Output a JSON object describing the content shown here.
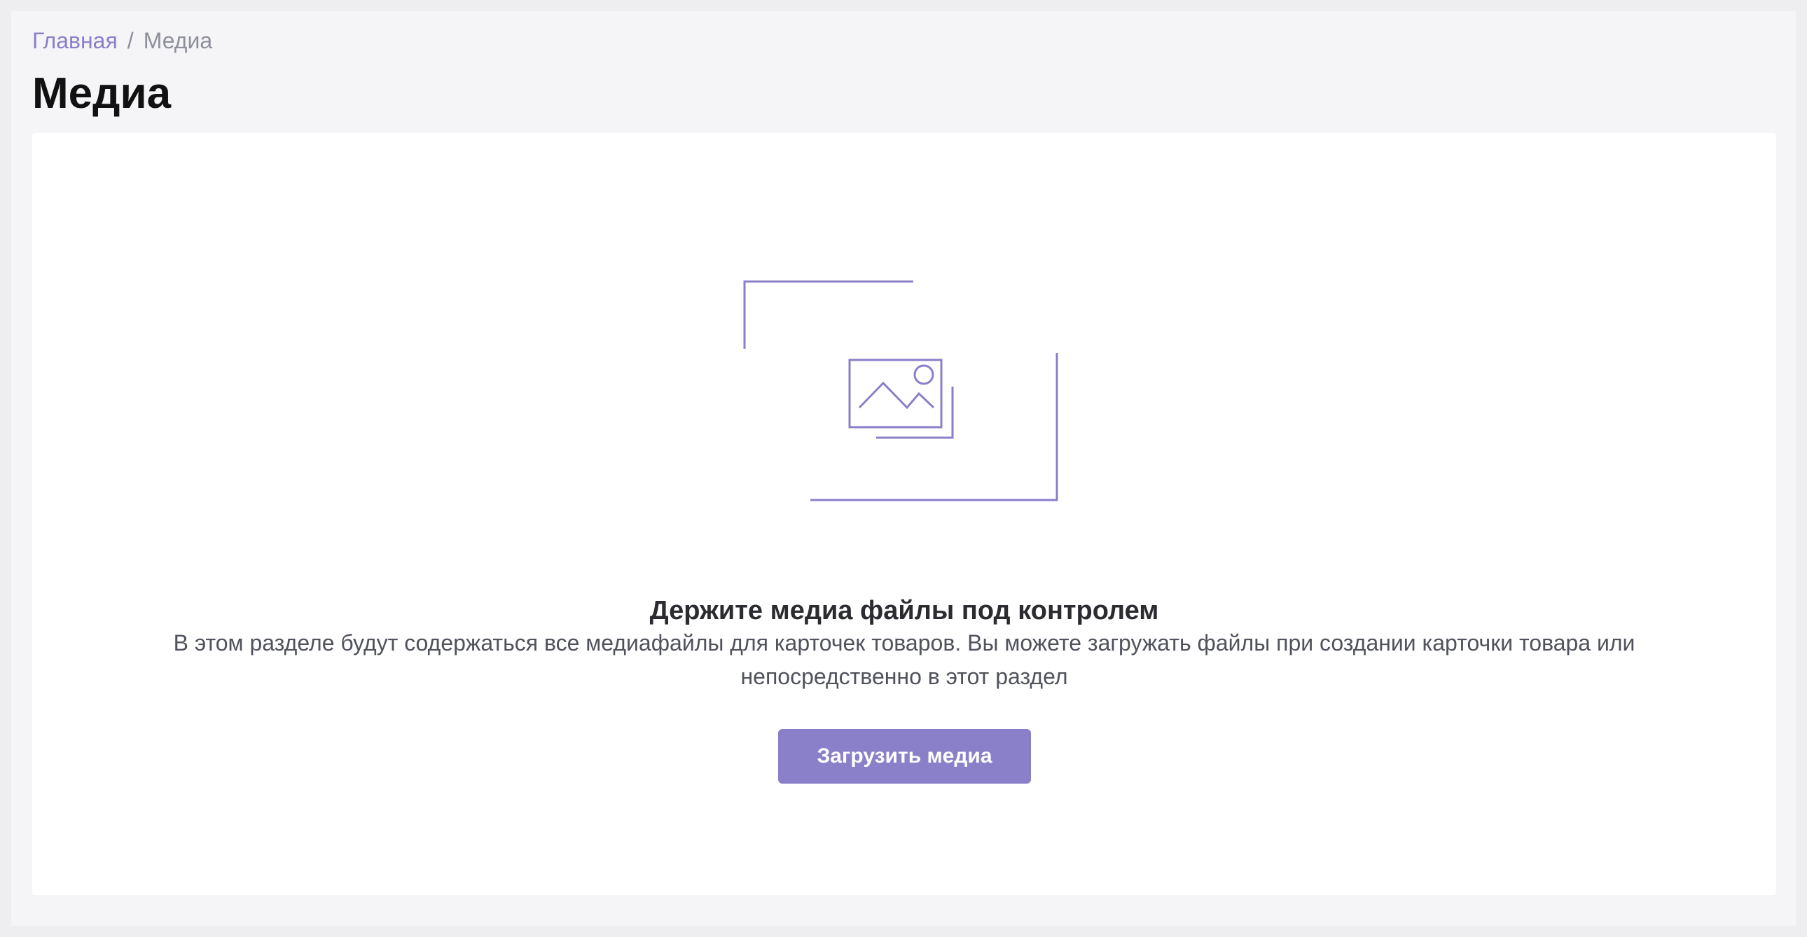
{
  "breadcrumb": {
    "home_label": "Главная",
    "separator": "/",
    "current_label": "Медиа"
  },
  "page": {
    "title": "Медиа"
  },
  "empty_state": {
    "illustration_icon": "image-placeholder-icon",
    "title": "Держите медиа файлы под контролем",
    "description": "В этом разделе будут содержаться все медиафайлы для карточек товаров. Вы можете загружать файлы при создании карточки товара или непосредственно в этот раздел",
    "button_label": "Загрузить медиа"
  },
  "colors": {
    "accent": "#8a7fc9",
    "page_background": "#f5f5f8",
    "card_background": "#ffffff",
    "title_text": "#111111",
    "muted_text": "#8d8f9a"
  }
}
